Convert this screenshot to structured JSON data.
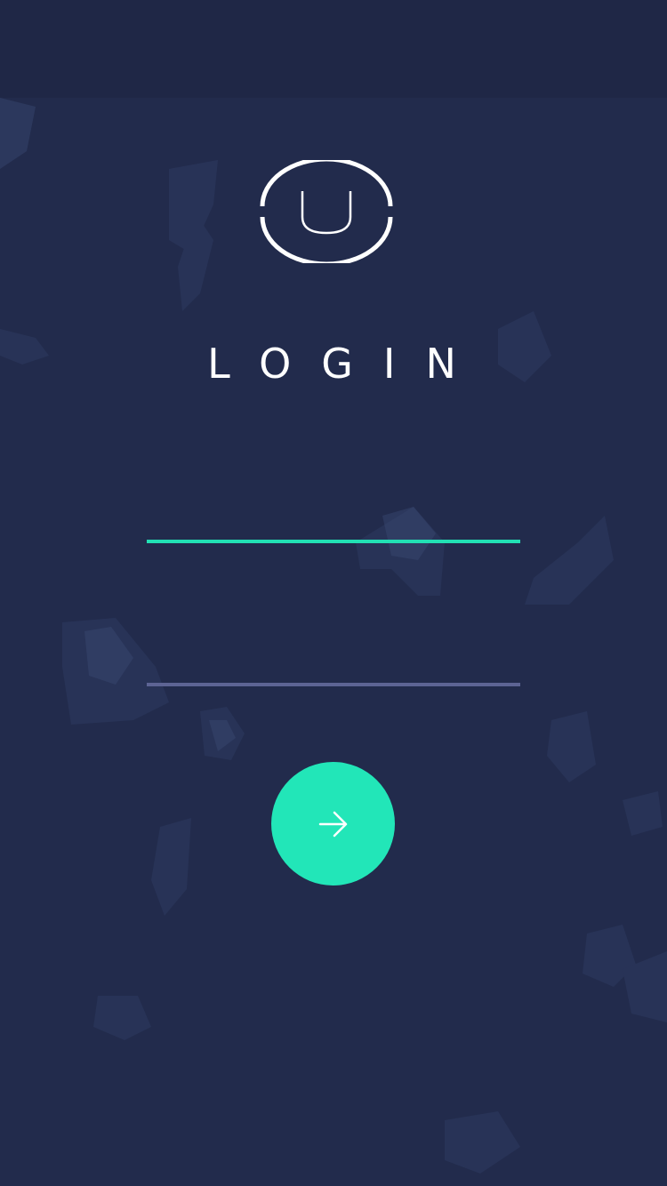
{
  "title": "LOGIN",
  "logo": {
    "letter": "U"
  },
  "form": {
    "username": {
      "value": "",
      "placeholder": ""
    },
    "password": {
      "value": "",
      "placeholder": ""
    },
    "submit": {
      "icon": "arrow-right-icon"
    }
  },
  "colors": {
    "background": "#1f2746",
    "accent": "#22e6b8",
    "inactive_line": "#5d6494",
    "text": "#ffffff"
  }
}
